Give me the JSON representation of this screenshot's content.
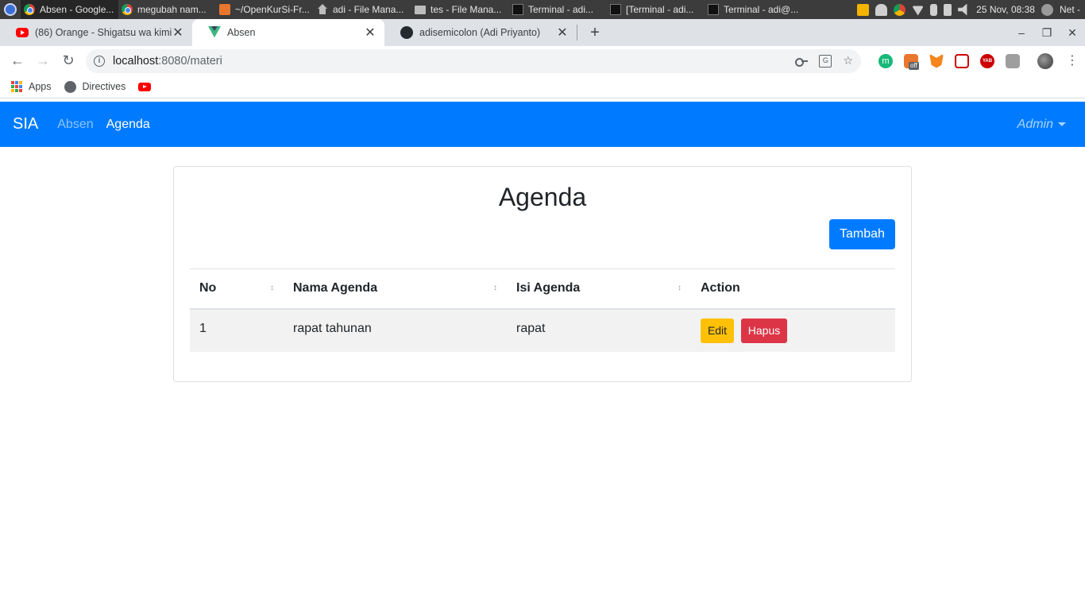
{
  "taskbar": {
    "tasks": [
      {
        "title": "Absen - Google...",
        "icon": "chrome-icon"
      },
      {
        "title": "megubah nam...",
        "icon": "chrome-icon"
      },
      {
        "title": "~/OpenKurSi-Fr...",
        "icon": "sublime-icon"
      },
      {
        "title": "adi - File Mana...",
        "icon": "home-folder-icon"
      },
      {
        "title": "tes - File Mana...",
        "icon": "folder-icon"
      },
      {
        "title": "Terminal - adi...",
        "icon": "terminal-icon"
      },
      {
        "title": "[Terminal - adi...",
        "icon": "terminal-icon"
      },
      {
        "title": "Terminal - adi@...",
        "icon": "terminal-icon"
      }
    ],
    "clock": "25 Nov, 08:38",
    "net": "Net -"
  },
  "browser": {
    "tabs": [
      {
        "title": "(86) Orange - Shigatsu wa kimi",
        "icon": "youtube-icon"
      },
      {
        "title": "Absen",
        "icon": "vue-icon"
      },
      {
        "title": "adisemicolon (Adi Priyanto)",
        "icon": "github-icon"
      }
    ],
    "new_tab": "+",
    "url_host": "localhost",
    "url_path": ":8080/materi",
    "bookmarks": [
      {
        "label": "Apps",
        "icon": "apps-grid-icon"
      },
      {
        "label": "Directives",
        "icon": "globe-icon"
      },
      {
        "label": "",
        "icon": "youtube-icon"
      }
    ],
    "extensions": [
      {
        "icon": "m-extension-icon",
        "text": "m"
      },
      {
        "icon": "off-extension-icon",
        "text": "off"
      },
      {
        "icon": "metamask-fox-icon",
        "text": ""
      },
      {
        "icon": "play-extension-icon",
        "text": ""
      },
      {
        "icon": "yab-extension-icon",
        "text": "YAB"
      },
      {
        "icon": "image-extension-icon",
        "text": ""
      }
    ]
  },
  "app": {
    "brand": "SIA",
    "nav": [
      {
        "label": "Absen",
        "active": false
      },
      {
        "label": "Agenda",
        "active": true
      }
    ],
    "user": "Admin"
  },
  "agenda": {
    "title": "Agenda",
    "add_label": "Tambah",
    "columns": [
      "No",
      "Nama Agenda",
      "Isi Agenda",
      "Action"
    ],
    "rows": [
      {
        "no": "1",
        "nama": "rapat tahunan",
        "isi": "rapat",
        "edit": "Edit",
        "hapus": "Hapus"
      }
    ]
  },
  "colors": {
    "primary": "#007bff",
    "warning": "#ffc107",
    "danger": "#dc3545"
  }
}
